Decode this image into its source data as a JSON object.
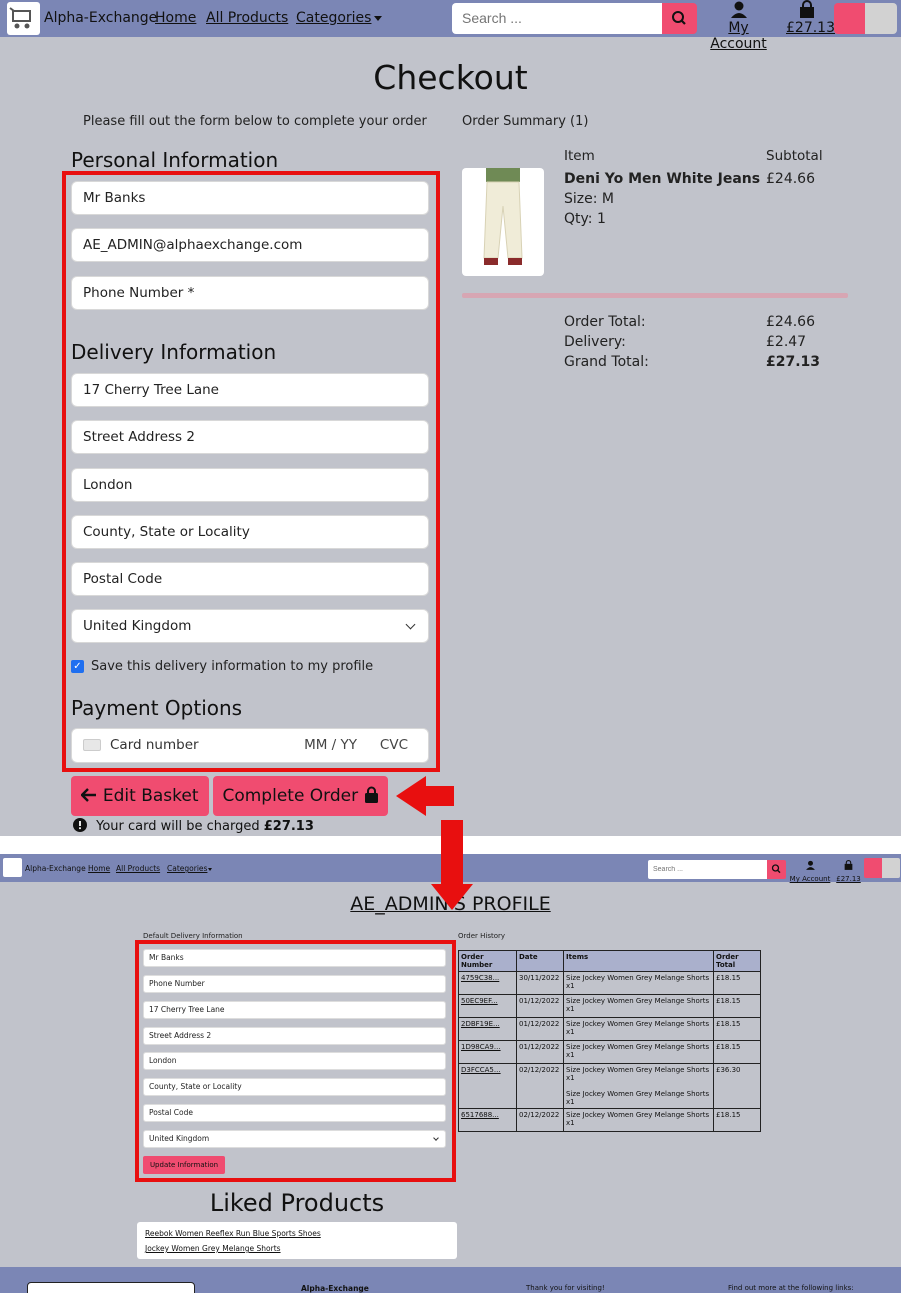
{
  "checkout_nav": {
    "brand": "Alpha-Exchange",
    "links": [
      "Home",
      "All Products",
      "Categories"
    ],
    "search_placeholder": "Search ...",
    "account_label": "My Account",
    "basket_total": "£27.13"
  },
  "checkout": {
    "title": "Checkout",
    "intro": "Please fill out the form below to complete your order",
    "personal_heading": "Personal Information",
    "full_name": "Mr Banks",
    "email": "AE_ADMIN@alphaexchange.com",
    "phone_placeholder": "Phone Number *",
    "delivery_heading": "Delivery Information",
    "street1": "17 Cherry Tree Lane",
    "street2_placeholder": "Street Address 2",
    "town": "London",
    "county_placeholder": "County, State or Locality",
    "postcode_placeholder": "Postal Code",
    "country": "United Kingdom",
    "save_info_label": "Save this delivery information to my profile",
    "save_info_checked": true,
    "payment_heading": "Payment Options",
    "card_placeholder": "Card number",
    "card_expiry_placeholder": "MM / YY",
    "card_cvc_placeholder": "CVC",
    "edit_basket_label": "Edit Basket",
    "complete_order_label": "Complete Order",
    "charge_notice_prefix": "Your card will be charged",
    "charge_amount": "£27.13"
  },
  "order_summary": {
    "heading": "Order Summary (1)",
    "item_col": "Item",
    "subtotal_col": "Subtotal",
    "product_name": "Deni Yo Men White Jeans",
    "product_size": "Size: M",
    "product_qty": "Qty: 1",
    "product_subtotal": "£24.66",
    "order_total_label": "Order Total:",
    "order_total": "£24.66",
    "delivery_label": "Delivery:",
    "delivery": "£2.47",
    "grand_total_label": "Grand Total:",
    "grand_total": "£27.13"
  },
  "profile_nav": {
    "brand": "Alpha-Exchange",
    "links": [
      "Home",
      "All Products",
      "Categories"
    ],
    "search_placeholder": "Search ...",
    "account_label": "My Account",
    "basket_total": "£27.13"
  },
  "profile": {
    "title": "AE_ADMIN'S PROFILE",
    "delivery_heading": "Default Delivery Information",
    "fields": [
      "Mr Banks",
      "Phone Number",
      "17 Cherry Tree Lane",
      "Street Address 2",
      "London",
      "County, State or Locality",
      "Postal Code"
    ],
    "country": "United Kingdom",
    "update_label": "Update Information",
    "history_heading": "Order History",
    "table_headers": [
      "Order Number",
      "Date",
      "Items",
      "Order Total"
    ],
    "orders": [
      {
        "number": "4759C38...",
        "date": "30/11/2022",
        "items": [
          "Size Jockey Women Grey Melange Shorts x1"
        ],
        "total": "£18.15"
      },
      {
        "number": "50EC9EF...",
        "date": "01/12/2022",
        "items": [
          "Size Jockey Women Grey Melange Shorts x1"
        ],
        "total": "£18.15"
      },
      {
        "number": "2DBF19E...",
        "date": "01/12/2022",
        "items": [
          "Size Jockey Women Grey Melange Shorts x1"
        ],
        "total": "£18.15"
      },
      {
        "number": "1D98CA9...",
        "date": "01/12/2022",
        "items": [
          "Size Jockey Women Grey Melange Shorts x1"
        ],
        "total": "£18.15"
      },
      {
        "number": "D3FCCA5...",
        "date": "02/12/2022",
        "items": [
          "Size Jockey Women Grey Melange Shorts x1",
          "Size Jockey Women Grey Melange Shorts x1"
        ],
        "total": "£36.30"
      },
      {
        "number": "6517688...",
        "date": "02/12/2022",
        "items": [
          "Size Jockey Women Grey Melange Shorts x1"
        ],
        "total": "£18.15"
      }
    ],
    "liked_heading": "Liked Products",
    "liked_products": [
      "Reebok Women Reeflex Run Blue Sports Shoes",
      "Jockey Women Grey Melange Shorts"
    ]
  },
  "footer": {
    "brand": "Alpha-Exchange",
    "thanks": "Thank you for visiting!",
    "links_intro": "Find out more at the following links:"
  },
  "colors": {
    "nav_bg": "#7b86b5",
    "page_bg": "#c1c3cb",
    "accent_pink": "#f04c70",
    "highlight_red": "#e80f0f"
  }
}
